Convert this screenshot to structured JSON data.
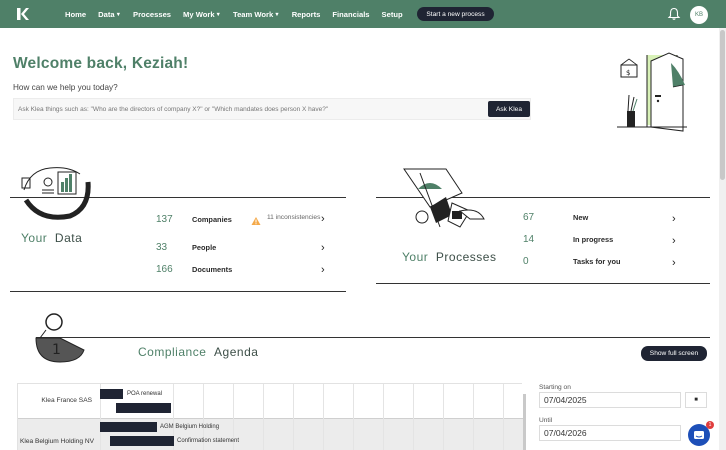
{
  "nav": {
    "items": [
      {
        "label": "Home",
        "dropdown": false
      },
      {
        "label": "Data",
        "dropdown": true
      },
      {
        "label": "Processes",
        "dropdown": false
      },
      {
        "label": "My Work",
        "dropdown": true
      },
      {
        "label": "Team Work",
        "dropdown": true
      },
      {
        "label": "Reports",
        "dropdown": false
      },
      {
        "label": "Financials",
        "dropdown": false
      },
      {
        "label": "Setup",
        "dropdown": false
      }
    ],
    "start_process": "Start a new process",
    "avatar_initials": "KB",
    "color": "#4f8068"
  },
  "welcome": {
    "title": "Welcome back, Keziah!",
    "help": "How can we help you today?",
    "ask_placeholder": "Ask Klea things such as: \"Who are the directors of company X?\" or \"Which mandates does person X have?\"",
    "ask_button": "Ask Klea"
  },
  "data_section": {
    "title_a": "Your",
    "title_b": "Data",
    "rows": [
      {
        "count": "137",
        "label": "Companies"
      },
      {
        "count": "33",
        "label": "People"
      },
      {
        "count": "166",
        "label": "Documents"
      }
    ],
    "inconsistencies": "11 inconsistencies"
  },
  "process_section": {
    "title_a": "Your",
    "title_b": "Processes",
    "rows": [
      {
        "count": "67",
        "label": "New"
      },
      {
        "count": "14",
        "label": "In progress"
      },
      {
        "count": "0",
        "label": "Tasks for you"
      }
    ]
  },
  "compliance": {
    "title_a": "Compliance",
    "title_b": "Agenda",
    "badge": "1",
    "show_full": "Show full screen",
    "rows": [
      {
        "name": "Klea France SAS",
        "items": [
          "POA renewal"
        ]
      },
      {
        "name": "Klea Belgium Holding NV",
        "items": [
          "AGM Belgium Holding",
          "Confirmation statement"
        ]
      }
    ],
    "starting_on_label": "Starting on",
    "starting_on": "07/04/2025",
    "until_label": "Until",
    "until": "07/04/2026",
    "chat_badge": "1"
  }
}
